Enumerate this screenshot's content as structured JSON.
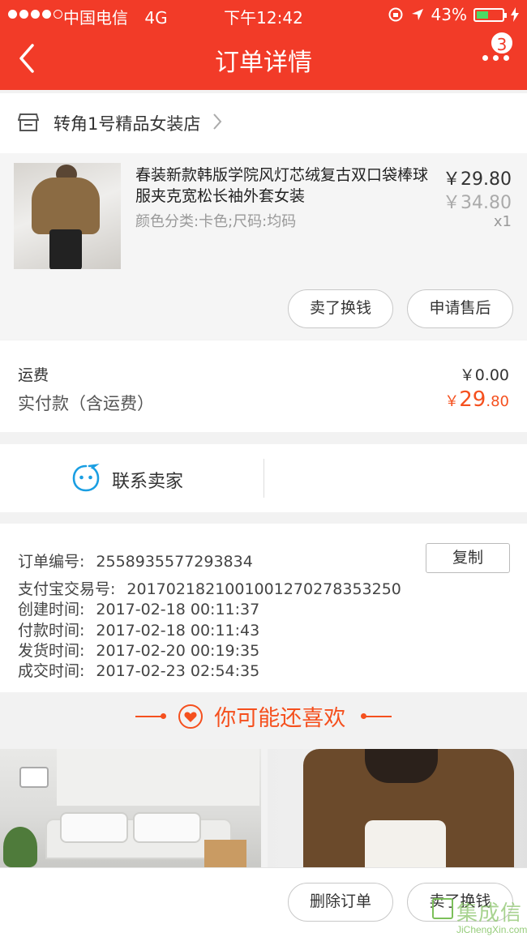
{
  "status_bar": {
    "carrier": "中国电信",
    "network": "4G",
    "time": "下午12:42",
    "battery": "43%"
  },
  "header": {
    "title": "订单详情",
    "badge_count": "3"
  },
  "store": {
    "name": "转角1号精品女装店"
  },
  "product": {
    "name": "春装新款韩版学院风灯芯绒复古双口袋棒球服夹克宽松长袖外套女装",
    "spec": "颜色分类:卡色;尺码:均码",
    "price": "￥29.80",
    "original_price": "￥34.80",
    "quantity": "x1",
    "resell_label": "卖了换钱",
    "after_sale_label": "申请售后"
  },
  "fees": {
    "shipping_label": "运费",
    "shipping_value": "￥0.00",
    "paid_label": "实付款（含运费）",
    "paid_currency": "￥",
    "paid_integer": "29",
    "paid_decimal": ".80"
  },
  "contact": {
    "label": "联系卖家"
  },
  "order_info": {
    "order_no_label": "订单编号:",
    "order_no": "2558935577293834",
    "copy_label": "复制",
    "alipay_label": "支付宝交易号:",
    "alipay_no": "2017021821001001270278353250",
    "created_label": "创建时间:",
    "created": "2017-02-18 00:11:37",
    "paid_label": "付款时间:",
    "paid": "2017-02-18 00:11:43",
    "shipped_label": "发货时间:",
    "shipped": "2017-02-20 00:19:35",
    "closed_label": "成交时间:",
    "closed": "2017-02-23 02:54:35"
  },
  "recommend": {
    "title": "你可能还喜欢"
  },
  "bottom_bar": {
    "delete_label": "删除订单",
    "resell_label": "卖了换钱"
  },
  "watermark": {
    "text": "集成信",
    "sub": "JiChengXin.com"
  },
  "colors": {
    "brand": "#f23b28",
    "accent": "#f5501e"
  }
}
